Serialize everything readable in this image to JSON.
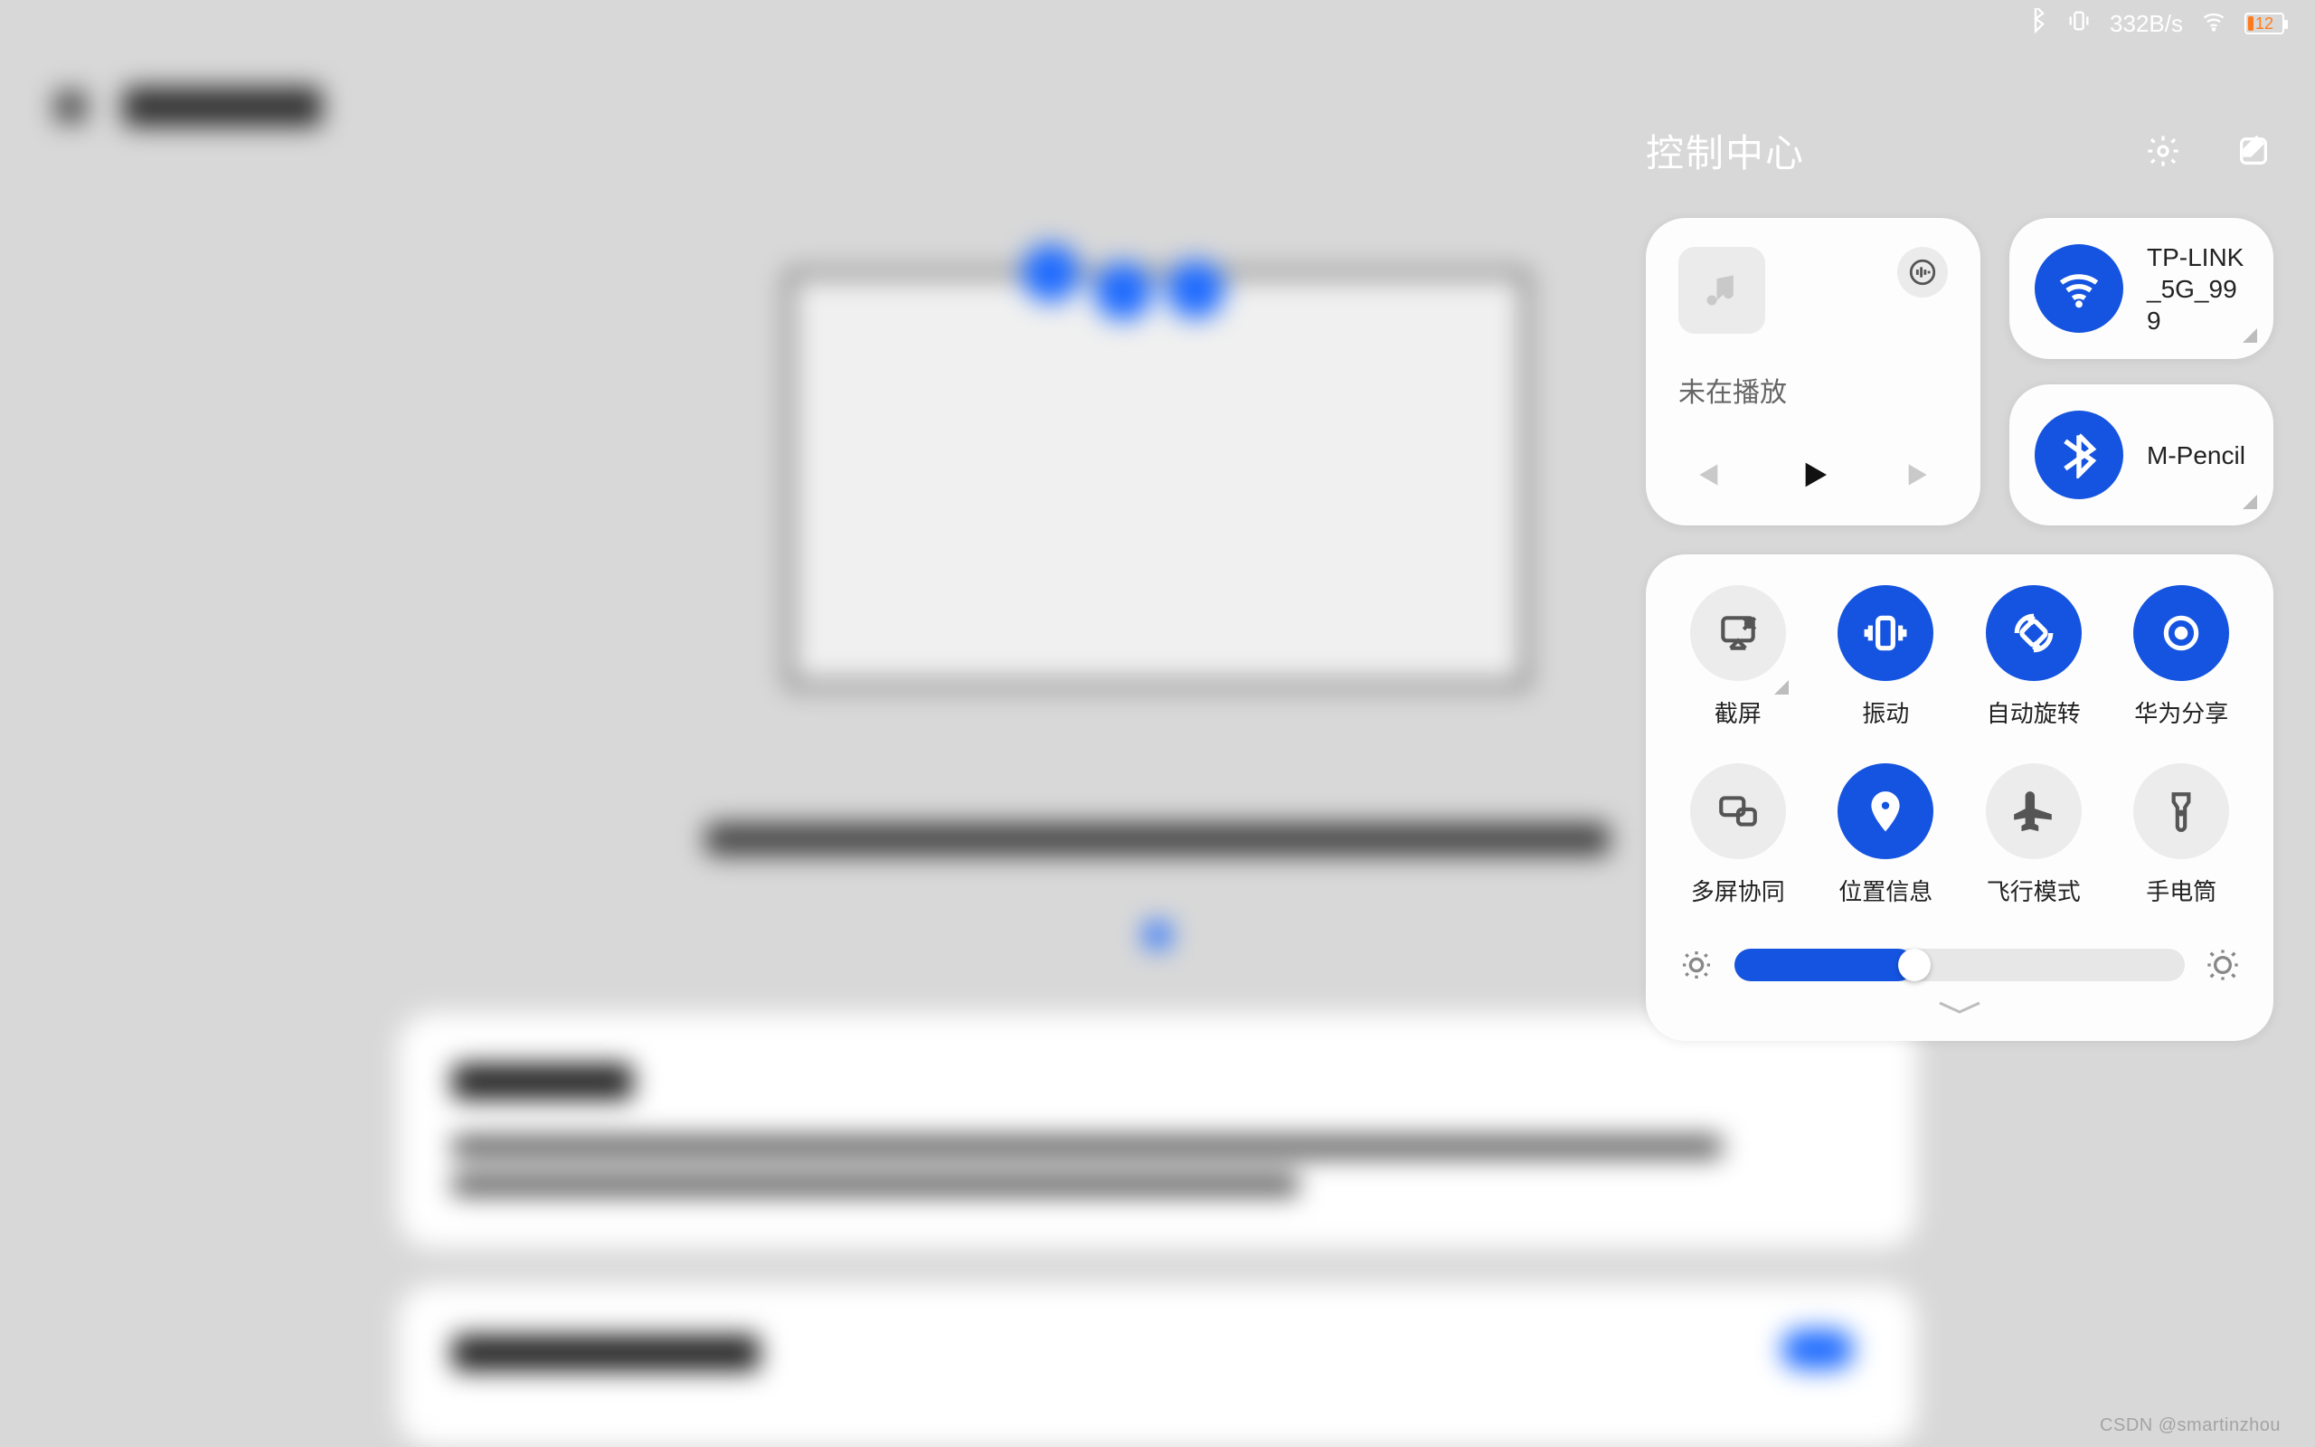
{
  "status_bar": {
    "net_speed": "332B/s",
    "battery_pct": "12"
  },
  "control_center": {
    "title": "控制中心",
    "media": {
      "status": "未在播放"
    },
    "wifi": {
      "label": "TP-LINK_5G_999"
    },
    "bluetooth": {
      "label": "M-Pencil"
    },
    "toggles": [
      {
        "id": "screenshot",
        "label": "截屏",
        "active": false,
        "expandable": true
      },
      {
        "id": "vibrate",
        "label": "振动",
        "active": true,
        "expandable": false
      },
      {
        "id": "autorotate",
        "label": "自动旋转",
        "active": true,
        "expandable": false
      },
      {
        "id": "huaweishare",
        "label": "华为分享",
        "active": true,
        "expandable": false
      },
      {
        "id": "multiscreen",
        "label": "多屏协同",
        "active": false,
        "expandable": false
      },
      {
        "id": "location",
        "label": "位置信息",
        "active": true,
        "expandable": false
      },
      {
        "id": "airplane",
        "label": "飞行模式",
        "active": false,
        "expandable": false
      },
      {
        "id": "flashlight",
        "label": "手电筒",
        "active": false,
        "expandable": false
      }
    ],
    "brightness_pct": 40
  },
  "watermark": "CSDN @smartinzhou"
}
